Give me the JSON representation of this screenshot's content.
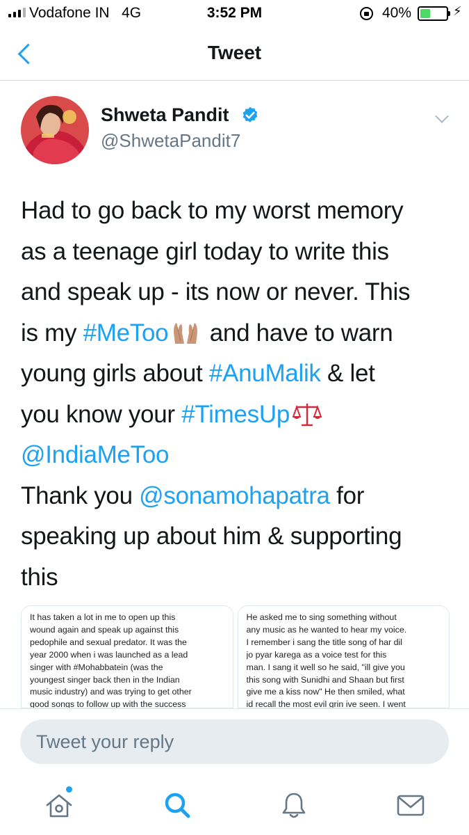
{
  "status_bar": {
    "carrier": "Vodafone IN",
    "network": "4G",
    "time": "3:52 PM",
    "battery_percent_text": "40%",
    "battery_level": 0.4
  },
  "nav": {
    "back_icon": "chevron-left-icon",
    "title": "Tweet"
  },
  "tweet": {
    "author": {
      "name": "Shweta Pandit",
      "handle": "@ShwetaPandit7",
      "verified": true
    },
    "lines": [
      [
        {
          "t": "Had to go back to my worst memory"
        }
      ],
      [
        {
          "t": "as a teenage girl today to write this"
        }
      ],
      [
        {
          "t": "and speak up - its now or never. This"
        }
      ],
      [
        {
          "t": "is my "
        },
        {
          "t": "#MeToo",
          "link": true
        },
        {
          "emoji": "raised-hands"
        },
        {
          "t": " and have to warn"
        }
      ],
      [
        {
          "t": "young girls about "
        },
        {
          "t": "#AnuMalik",
          "link": true
        },
        {
          "t": " & let"
        }
      ],
      [
        {
          "t": "you know your "
        },
        {
          "t": "#TimesUp",
          "link": true
        },
        {
          "emoji": "scales"
        }
      ],
      [
        {
          "t": "@IndiaMeToo",
          "link": true
        }
      ],
      [
        {
          "t": "Thank you "
        },
        {
          "t": "@sonamohapatra",
          "link": true
        },
        {
          "t": " for"
        }
      ],
      [
        {
          "t": "speaking up about him & supporting"
        }
      ],
      [
        {
          "t": "this"
        }
      ]
    ],
    "media": [
      {
        "lines": [
          "It has taken a lot in me to open up this",
          "wound again and speak up against this",
          "pedophile and sexual predator. It was the",
          "year 2000 when i was launched as a lead",
          "singer with #Mohabbatein (was the",
          "youngest singer back then in the Indian",
          "music industry) and was trying to get other",
          "good songs to follow up with the success"
        ]
      },
      {
        "lines": [
          "He asked me to sing something without",
          "any music as he wanted to hear my voice.",
          "I remember i sang the title song of har dil",
          "jo pyar karega as a voice test for this",
          "man. I sang it well so he said, \"ill give you",
          "this song with Sunidhi and Shaan but first",
          "give me a kiss now\" He then smiled, what",
          "id recall the most evil grin ive seen. I went"
        ]
      }
    ]
  },
  "reply": {
    "placeholder": "Tweet your reply"
  },
  "tab_bar": {
    "tabs": [
      "home-icon",
      "search-icon",
      "notifications-icon",
      "messages-icon"
    ],
    "active": "search-icon",
    "home_has_new": true
  },
  "colors": {
    "accent": "#1da1f2",
    "text": "#14171a",
    "secondary": "#657786",
    "battery": "#4cd964"
  }
}
